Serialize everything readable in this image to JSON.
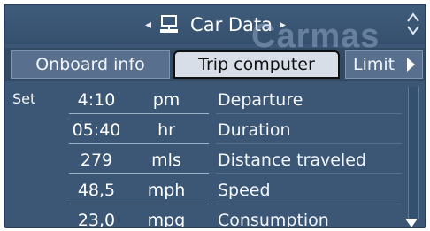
{
  "header": {
    "title": "Car Data",
    "watermark": "Carmas",
    "left_arrow_icon": "left-arrow-icon",
    "right_arrow_icon": "right-arrow-icon",
    "monitor_icon": "monitor-icon",
    "corner_icon": "scroll-updown-icon"
  },
  "tabs": [
    {
      "label": "Onboard info",
      "selected": false
    },
    {
      "label": "Trip computer",
      "selected": true
    },
    {
      "label": "Limit",
      "selected": false
    }
  ],
  "content": {
    "set_label": "Set",
    "rows": [
      {
        "value": "4:10",
        "unit": "pm",
        "label": "Departure"
      },
      {
        "value": "05:40",
        "unit": "hr",
        "label": "Duration"
      },
      {
        "value": "279",
        "unit": "mls",
        "label": "Distance traveled"
      },
      {
        "value": "48,5",
        "unit": "mph",
        "label": "Speed"
      },
      {
        "value": "23,0",
        "unit": "mpg",
        "label": "Consumption"
      }
    ],
    "scroll_down_icon": "down-arrow-icon"
  },
  "colors": {
    "screen_bg": "#3b5775",
    "tab_selected_bg": "#d8dee8",
    "text_light": "#ffffff"
  }
}
